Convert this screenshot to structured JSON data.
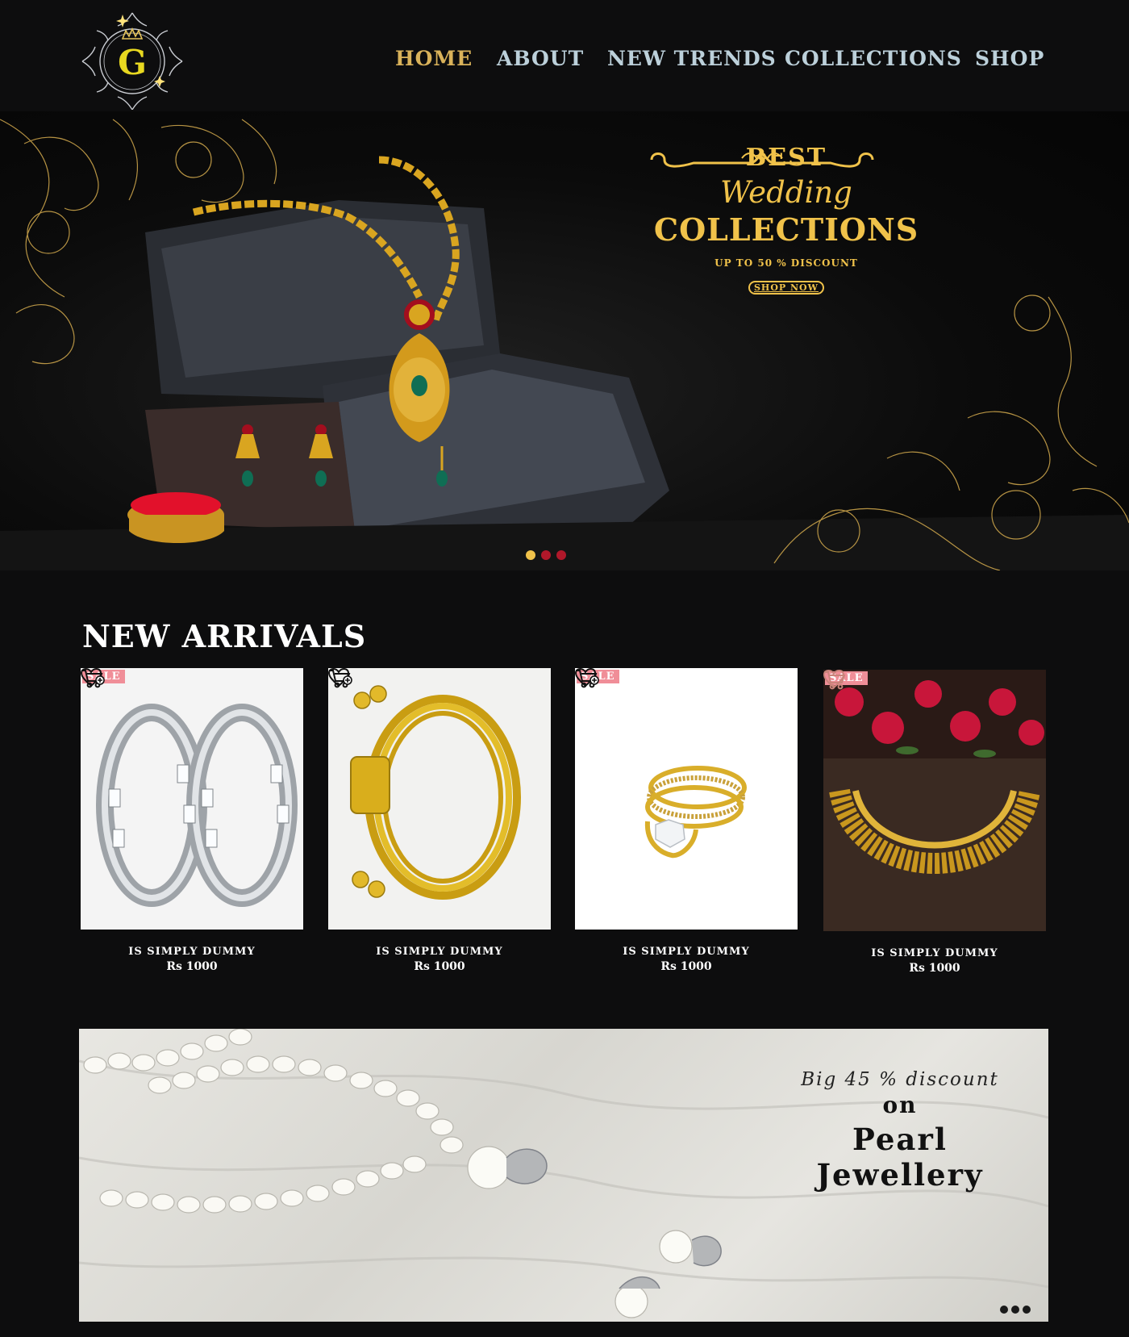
{
  "header": {
    "logo_letter": "G",
    "nav": [
      {
        "label": "HOME",
        "active": true
      },
      {
        "label": "ABOUT",
        "active": false
      },
      {
        "label": "NEW TRENDS",
        "active": false
      },
      {
        "label": "COLLECTIONS",
        "active": false
      },
      {
        "label": "SHOP",
        "active": false
      }
    ]
  },
  "hero": {
    "line1": "BEST",
    "line2": "Wedding",
    "line3": "COLLECTIONS",
    "discount": "UP TO 50 % DISCOUNT",
    "cta": "SHOP NOW",
    "slides": 3,
    "active_slide": 1
  },
  "new_arrivals": {
    "title": "NEW ARRIVALS",
    "products": [
      {
        "name": "IS SIMPLY DUMMY",
        "price": "Rs 1000",
        "sale": "SALE",
        "image": "silver-hoop-earrings"
      },
      {
        "name": "IS SIMPLY DUMMY",
        "price": "Rs 1000",
        "sale": "",
        "image": "gold-bangles"
      },
      {
        "name": "IS SIMPLY DUMMY",
        "price": "Rs 1000",
        "sale": "SALE",
        "image": "gold-diamond-ring"
      },
      {
        "name": "IS SIMPLY DUMMY",
        "price": "Rs 1000",
        "sale": "SALE",
        "image": "gold-necklace-roses"
      }
    ]
  },
  "banner": {
    "line1": "Big 45 % discount",
    "line2": "on",
    "line3": "Pearl Jewellery",
    "slides": 3
  },
  "colors": {
    "background": "#0d0d0e",
    "gold": "#f0c24a",
    "nav_active": "#d9b25a",
    "nav_text": "#bcd0da",
    "sale_badge": "#f08e98"
  }
}
